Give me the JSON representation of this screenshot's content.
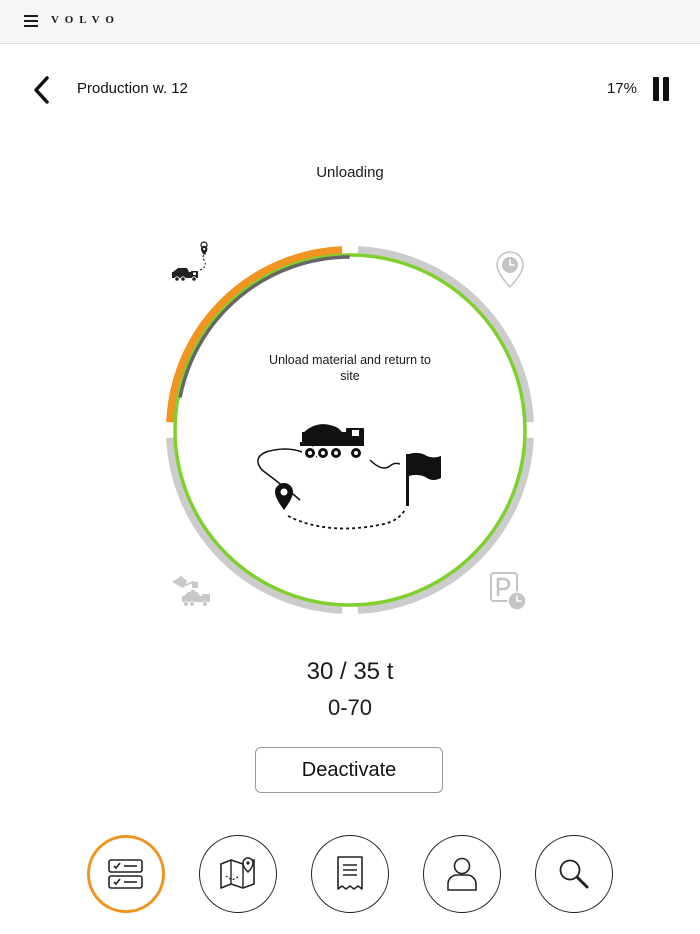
{
  "header": {
    "brand": "VOLVO",
    "menu_icon": "hamburger-menu-icon"
  },
  "toolbar": {
    "title": "Production w. 12",
    "progress_label": "17%",
    "back_icon": "chevron-left-icon",
    "pause_icon": "pause-icon"
  },
  "cycle": {
    "phase": "Unloading",
    "instruction": "Unload material and return to site",
    "stage_progress": 0.22,
    "phases": [
      {
        "name": "haul",
        "icon": "truck-route-icon",
        "active": true
      },
      {
        "name": "wait",
        "icon": "location-clock-icon",
        "active": false
      },
      {
        "name": "park",
        "icon": "parking-clock-icon",
        "active": false
      },
      {
        "name": "load",
        "icon": "loader-truck-icon",
        "active": false
      }
    ],
    "colors": {
      "active": "#f29422",
      "inactive": "#cccccc",
      "ring": "#7ed12d",
      "progress": "#666666"
    }
  },
  "load": {
    "amount": "30 / 35 t",
    "range": "0-70"
  },
  "actions": {
    "deactivate_label": "Deactivate"
  },
  "bottom_nav": {
    "items": [
      {
        "name": "tasks",
        "icon": "task-list-icon",
        "active": true
      },
      {
        "name": "map",
        "icon": "map-icon",
        "active": false
      },
      {
        "name": "report",
        "icon": "receipt-icon",
        "active": false
      },
      {
        "name": "profile",
        "icon": "person-icon",
        "active": false
      },
      {
        "name": "search",
        "icon": "search-icon",
        "active": false
      }
    ],
    "active_color": "#f29422"
  }
}
